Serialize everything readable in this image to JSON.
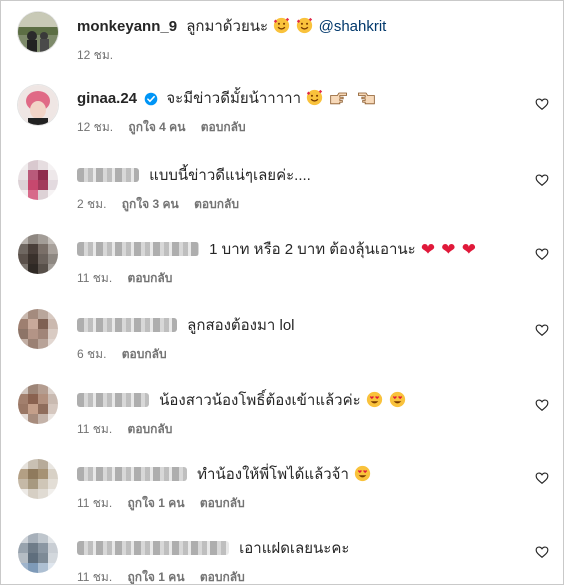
{
  "colors": {
    "text": "#262626",
    "meta": "#737373",
    "verified": "#0095f6",
    "mention": "#00376b"
  },
  "comments": [
    {
      "username": "monkeyann_9",
      "text": "ลูกมาด้วยนะ",
      "mention": "@shahkrit",
      "time": "12 ชม.",
      "likes": "",
      "reply": ""
    },
    {
      "username": "ginaa.24",
      "text": "จะมีข่าวดีมั้ยน้าาาาา",
      "time": "12 ชม.",
      "likes": "ถูกใจ 4 คน",
      "reply": "ตอบกลับ"
    },
    {
      "username": "",
      "text": "แบบนี้ข่าวดีแน่ๆเลยค่ะ....",
      "time": "2 ชม.",
      "likes": "ถูกใจ 3 คน",
      "reply": "ตอบกลับ"
    },
    {
      "username": "",
      "text": "1 บาท หรือ 2 บาท ต้องลุ้นเอานะ",
      "time": "11 ชม.",
      "likes": "",
      "reply": "ตอบกลับ"
    },
    {
      "username": "",
      "text": "ลูกสองต้องมา lol",
      "time": "6 ชม.",
      "likes": "",
      "reply": "ตอบกลับ"
    },
    {
      "username": "",
      "text": "น้องสาวน้องโพธิ์ต้องเข้าแล้วค่ะ",
      "time": "11 ชม.",
      "likes": "",
      "reply": "ตอบกลับ"
    },
    {
      "username": "",
      "text": "ทำน้องให้พี่โพได้แล้วจ้า",
      "time": "11 ชม.",
      "likes": "ถูกใจ 1 คน",
      "reply": "ตอบกลับ"
    },
    {
      "username": "",
      "text": "เอาแฝดเลยนะคะ",
      "time": "11 ชม.",
      "likes": "ถูกใจ 1 คน",
      "reply": "ตอบกลับ"
    }
  ],
  "icons": {
    "like": "heart-outline-icon",
    "verified": "verified-badge-icon"
  }
}
